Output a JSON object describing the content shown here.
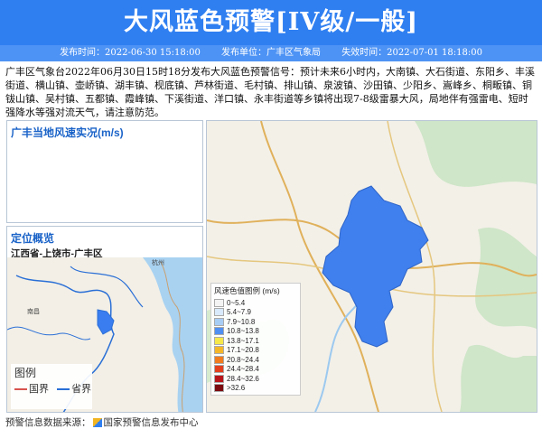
{
  "header": {
    "title": "大风蓝色预警[IV级/一般]"
  },
  "meta": {
    "publish_time": "发布时间：2022-06-30 15:18:00",
    "publish_unit": "发布单位：广丰区气象局",
    "expire_time": "失效时间：2022-07-01 18:18:00"
  },
  "description": "广丰区气象台2022年06月30日15时18分发布大风蓝色预警信号：预计未来6小时内，大南镇、大石街道、东阳乡、丰溪街道、横山镇、壶峤镇、湖丰镇、枧底镇、芦林街道、毛村镇、排山镇、泉波镇、沙田镇、少阳乡、嵩峰乡、桐畈镇、铜钹山镇、吴村镇、五都镇、霞峰镇、下溪街道、洋口镇、永丰街道等乡镇将出现7-8级雷暴大风，局地伴有强雷电、短时强降水等强对流天气，请注意防范。",
  "wind_panel": {
    "title": "广丰当地风速实况(m/s)"
  },
  "location_panel": {
    "title": "定位概览",
    "location": "江西省-上饶市-广丰区",
    "city_labels": [
      "杭州",
      "南昌"
    ],
    "legend_title": "图例",
    "legend_items": [
      {
        "label": "国界",
        "color": "#d9534f"
      },
      {
        "label": "省界",
        "color": "#2a6fd6"
      }
    ]
  },
  "wind_legend": {
    "title": "风速色值图例 (m/s)",
    "items": [
      {
        "label": "0~5.4",
        "color": "#f4f4f4"
      },
      {
        "label": "5.4~7.9",
        "color": "#d8eafc"
      },
      {
        "label": "7.9~10.8",
        "color": "#a7cdf5"
      },
      {
        "label": "10.8~13.8",
        "color": "#4f8ff2"
      },
      {
        "label": "13.8~17.1",
        "color": "#f6e84a"
      },
      {
        "label": "17.1~20.8",
        "color": "#f5b72a"
      },
      {
        "label": "20.8~24.4",
        "color": "#f07c1f"
      },
      {
        "label": "24.4~28.4",
        "color": "#e3401e"
      },
      {
        "label": "28.4~32.6",
        "color": "#b8151a"
      },
      {
        "label": ">32.6",
        "color": "#7a0a0f"
      }
    ]
  },
  "footer": {
    "source_label": "预警信息数据来源：",
    "source_name": "国家预警信息发布中心"
  }
}
